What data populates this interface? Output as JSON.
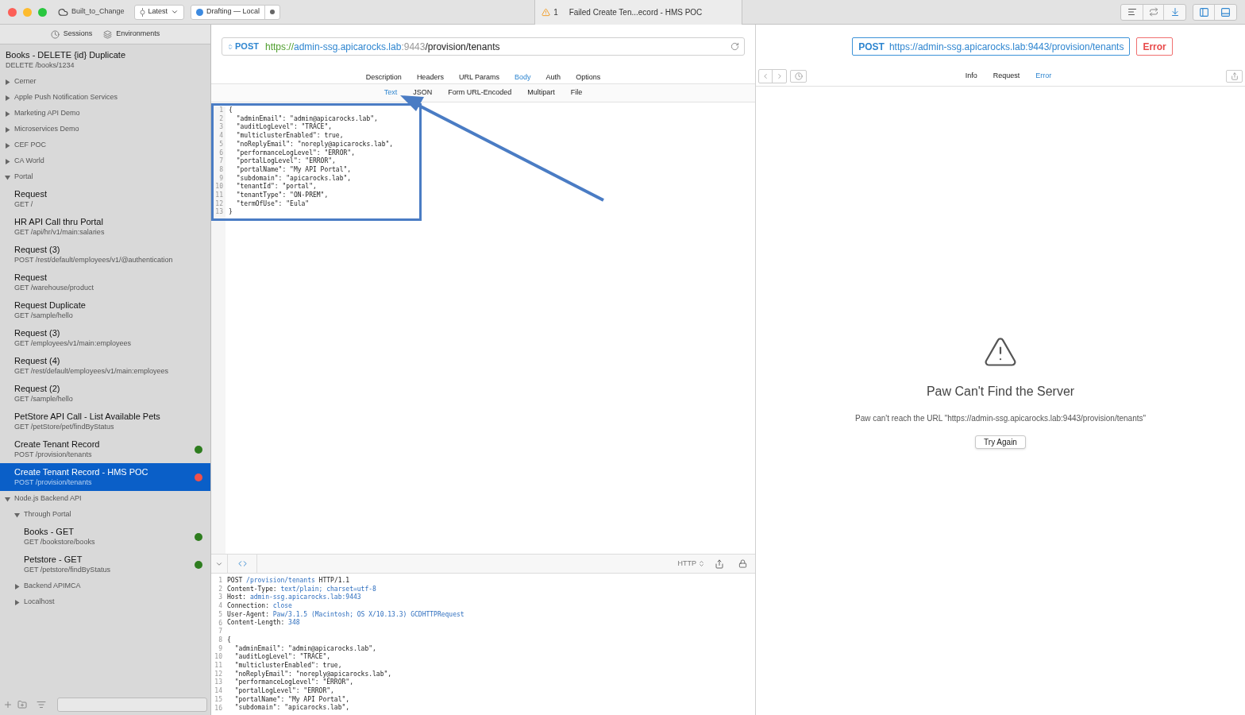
{
  "titlebar": {
    "workspace": "Built_to_Change",
    "version": "Latest",
    "sync": "Drafting — Local",
    "tab": {
      "warning_count": "1",
      "title": "Failed Create Ten...ecord - HMS POC"
    }
  },
  "sidebar": {
    "tabs": [
      {
        "label": "Sessions",
        "selected": false
      },
      {
        "label": "Environments",
        "selected": false
      }
    ],
    "items": [
      {
        "kind": "request",
        "name": "Books - DELETE {id} Duplicate",
        "path": "DELETE /books/1234",
        "selected": false
      },
      {
        "kind": "group",
        "name": "Cerner",
        "expanded": false
      },
      {
        "kind": "group",
        "name": "Apple Push Notification Services",
        "expanded": false
      },
      {
        "kind": "group",
        "name": "Marketing API Demo",
        "expanded": false
      },
      {
        "kind": "group",
        "name": "Microservices Demo",
        "expanded": false
      },
      {
        "kind": "group",
        "name": "CEF POC",
        "expanded": false
      },
      {
        "kind": "group",
        "name": "CA World",
        "expanded": false
      },
      {
        "kind": "group",
        "name": "Portal",
        "expanded": true,
        "children": [
          {
            "kind": "request",
            "name": "Request",
            "path": "GET /",
            "selected": false
          },
          {
            "kind": "request",
            "name": "HR API Call thru Portal",
            "path": "GET /api/hr/v1/main:salaries",
            "selected": false
          },
          {
            "kind": "request",
            "name": "Request (3)",
            "path": "POST /rest/default/employees/v1/@authentication",
            "selected": false
          },
          {
            "kind": "request",
            "name": "Request",
            "path": "GET /warehouse/product",
            "selected": false
          },
          {
            "kind": "request",
            "name": "Request Duplicate",
            "path": "GET /sample/hello",
            "selected": false
          },
          {
            "kind": "request",
            "name": "Request (3)",
            "path": "GET /employees/v1/main:employees",
            "selected": false
          },
          {
            "kind": "request",
            "name": "Request (4)",
            "path": "GET /rest/default/employees/v1/main:employees",
            "selected": false
          },
          {
            "kind": "request",
            "name": "Request (2)",
            "path": "GET /sample/hello",
            "selected": false
          },
          {
            "kind": "request",
            "name": "PetStore API Call - List Available Pets",
            "path": "GET /petStore/pet/findByStatus",
            "selected": false
          },
          {
            "kind": "request",
            "name": "Create Tenant Record",
            "path": "POST /provision/tenants",
            "selected": false,
            "color": "#2e7d1f"
          },
          {
            "kind": "request",
            "name": "Create Tenant Record - HMS POC",
            "path": "POST /provision/tenants",
            "selected": true,
            "color": "#f0504a"
          }
        ]
      },
      {
        "kind": "group",
        "name": "Node.js Backend API",
        "expanded": true,
        "children": [
          {
            "kind": "group",
            "name": "Through Portal",
            "expanded": true,
            "children": [
              {
                "kind": "request",
                "name": "Books - GET",
                "path": "GET /bookstore/books",
                "selected": false,
                "color": "#2e7d1f"
              },
              {
                "kind": "request",
                "name": "Petstore - GET",
                "path": "GET /petstore/findByStatus",
                "selected": false,
                "color": "#2e7d1f"
              }
            ]
          },
          {
            "kind": "group",
            "name": "Backend APIMCA",
            "expanded": false
          },
          {
            "kind": "group",
            "name": "Localhost",
            "expanded": false
          }
        ]
      }
    ]
  },
  "request": {
    "method": "POST",
    "url": [
      {
        "kind": "scheme",
        "text": "https://"
      },
      {
        "kind": "host",
        "text": "admin-ssg.apicarocks.lab"
      },
      {
        "kind": "port",
        "text": ":9443"
      },
      {
        "kind": "path",
        "text": "/provision/tenants"
      }
    ],
    "tabs": [
      {
        "label": "Description",
        "selected": false
      },
      {
        "label": "Headers",
        "selected": false
      },
      {
        "label": "URL Params",
        "selected": false
      },
      {
        "label": "Body",
        "selected": true
      },
      {
        "label": "Auth",
        "selected": false
      },
      {
        "label": "Options",
        "selected": false
      }
    ],
    "body_tabs": [
      {
        "label": "Text",
        "selected": true
      },
      {
        "label": "JSON",
        "selected": false
      },
      {
        "label": "Form URL-Encoded",
        "selected": false
      },
      {
        "label": "Multipart",
        "selected": false
      },
      {
        "label": "File",
        "selected": false
      }
    ],
    "body_lines": [
      {
        "number": "1",
        "text": "{"
      },
      {
        "number": "2",
        "text": "  \"adminEmail\": \"admin@apicarocks.lab\","
      },
      {
        "number": "3",
        "text": "  \"auditLogLevel\": \"TRACE\","
      },
      {
        "number": "4",
        "text": "  \"multiclusterEnabled\": true,"
      },
      {
        "number": "5",
        "text": "  \"noReplyEmail\": \"noreply@apicarocks.lab\","
      },
      {
        "number": "6",
        "text": "  \"performanceLogLevel\": \"ERROR\","
      },
      {
        "number": "7",
        "text": "  \"portalLogLevel\": \"ERROR\","
      },
      {
        "number": "8",
        "text": "  \"portalName\": \"My API Portal\","
      },
      {
        "number": "9",
        "text": "  \"subdomain\": \"apicarocks.lab\","
      },
      {
        "number": "10",
        "text": "  \"tenantId\": \"portal\","
      },
      {
        "number": "11",
        "text": "  \"tenantType\": \"ON-PREM\","
      },
      {
        "number": "12",
        "text": "  \"termOfUse\": \"Eula\""
      },
      {
        "number": "13",
        "text": "}"
      }
    ]
  },
  "preview": {
    "format": "HTTP",
    "lines": [
      {
        "number": "1",
        "head": "POST ",
        "value": "/provision/tenants",
        "tail": " HTTP/1.1"
      },
      {
        "number": "2",
        "head": "Content-Type: ",
        "value": "text/plain; charset=utf-8"
      },
      {
        "number": "3",
        "head": "Host: ",
        "value": "admin-ssg.apicarocks.lab:9443"
      },
      {
        "number": "4",
        "head": "Connection: ",
        "value": "close"
      },
      {
        "number": "5",
        "head": "User-Agent: ",
        "value": "Paw/3.1.5 (Macintosh; OS X/10.13.3) GCDHTTPRequest"
      },
      {
        "number": "6",
        "head": "Content-Length: ",
        "value": "348"
      },
      {
        "number": "7"
      },
      {
        "number": "8",
        "head": "{"
      },
      {
        "number": "9",
        "head": "  \"adminEmail\": \"admin@apicarocks.lab\","
      },
      {
        "number": "10",
        "head": "  \"auditLogLevel\": \"TRACE\","
      },
      {
        "number": "11",
        "head": "  \"multiclusterEnabled\": true,"
      },
      {
        "number": "12",
        "head": "  \"noReplyEmail\": \"noreply@apicarocks.lab\","
      },
      {
        "number": "13",
        "head": "  \"performanceLogLevel\": \"ERROR\","
      },
      {
        "number": "14",
        "head": "  \"portalLogLevel\": \"ERROR\","
      },
      {
        "number": "15",
        "head": "  \"portalName\": \"My API Portal\","
      },
      {
        "number": "16",
        "head": "  \"subdomain\": \"apicarocks.lab\","
      }
    ]
  },
  "response": {
    "method": "POST",
    "url": "https://admin-ssg.apicarocks.lab:9443/provision/tenants",
    "status": "Error",
    "tabs": [
      {
        "label": "Info",
        "selected": false
      },
      {
        "label": "Request",
        "selected": false
      },
      {
        "label": "Error",
        "selected": true
      }
    ],
    "error_title": "Paw Can't Find the Server",
    "error_message": "Paw can't reach the URL \"https://admin-ssg.apicarocks.lab:9443/provision/tenants\"",
    "retry": "Try Again"
  }
}
